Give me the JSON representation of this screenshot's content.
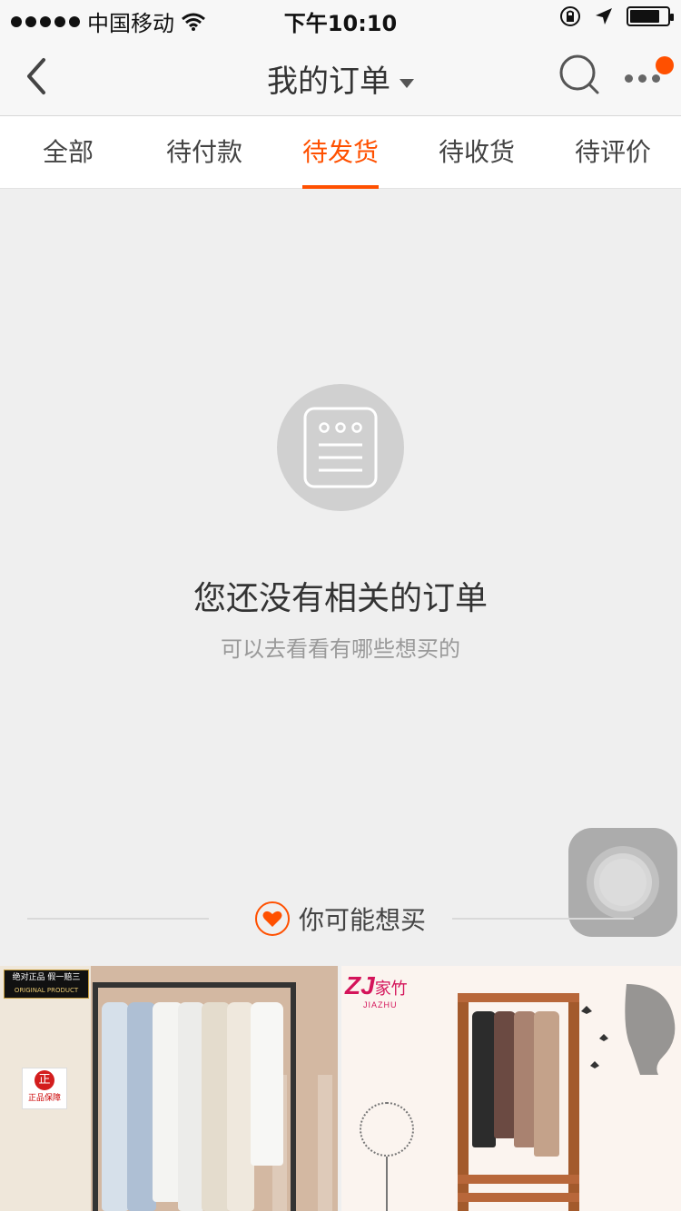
{
  "status_bar": {
    "carrier": "中国移动",
    "time": "下午10:10"
  },
  "nav": {
    "title": "我的订单",
    "back_icon": "chevron-left-icon",
    "search_icon": "search-icon",
    "more_icon": "more-dots-icon"
  },
  "tabs": [
    {
      "label": "全部",
      "active": false
    },
    {
      "label": "待付款",
      "active": false
    },
    {
      "label": "待发货",
      "active": true
    },
    {
      "label": "待收货",
      "active": false
    },
    {
      "label": "待评价",
      "active": false
    }
  ],
  "empty_state": {
    "icon": "order-list-icon",
    "title": "您还没有相关的订单",
    "subtitle": "可以去看看有哪些想买的"
  },
  "recommend": {
    "label": "你可能想买",
    "icon": "heart-icon"
  },
  "products": [
    {
      "badge_line1": "绝对正品 假一赔三",
      "badge_line2": "ORIGINAL PRODUCT",
      "badge_zheng_mark": "正",
      "badge_zheng_label": "正品保障"
    },
    {
      "brand_zj": "ZJ",
      "brand_name": "家竹",
      "brand_sub": "JIAZHU"
    }
  ],
  "colors": {
    "accent": "#ff5000",
    "background": "#efefef"
  }
}
